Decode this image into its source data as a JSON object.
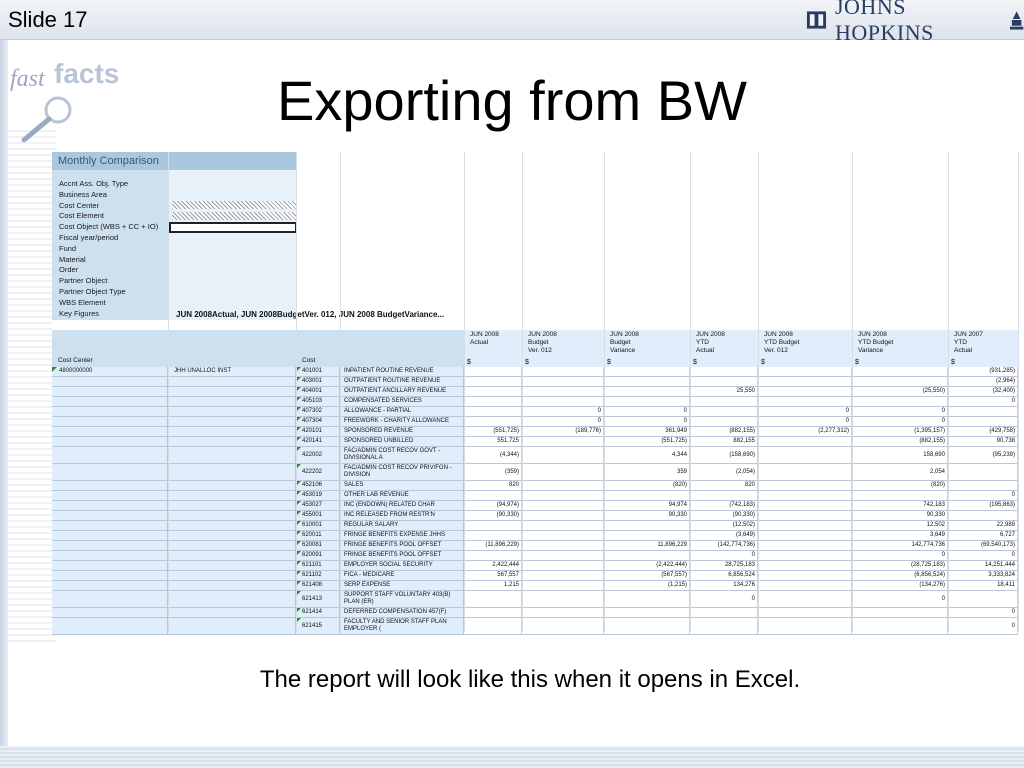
{
  "slide": {
    "label": "Slide 17",
    "brand": "JOHNS HOPKINS",
    "fastfacts_a": "fast",
    "fastfacts_b": "facts",
    "title": "Exporting from BW",
    "caption": "The report will look like this when it opens in Excel."
  },
  "sheet": {
    "header": "Monthly Comparison",
    "filters": [
      "Accnt Ass. Obj. Type",
      "Business Area",
      "Cost Center",
      "Cost Element",
      "Cost Object (WBS + CC + IO)",
      "Fiscal year/period",
      "Fund",
      "Material",
      "Order",
      "Partner Object",
      "Partner Object Type",
      "WBS Element",
      "Key Figures"
    ],
    "key_figures_value": "JUN 2008Actual, JUN 2008BudgetVer. 012, JUN 2008 BudgetVariance...",
    "cost_center_label": "Cost Center",
    "cost_label": "Cost",
    "currency": "$",
    "columns": [
      "JUN 2008\nActual",
      "JUN 2008\nBudget\nVer. 012",
      "JUN 2008\nBudget\nVariance",
      "JUN 2008\nYTD\nActual",
      "JUN 2008\nYTD Budget\nVer. 012",
      "JUN 2008\nYTD Budget\nVariance",
      "JUN 2007\nYTD\nActual"
    ],
    "cost_center": "4800000000",
    "cost_center_name": "JHH UNALLOC INST",
    "rows": [
      {
        "acct": "401001",
        "desc": "INPATIENT ROUTINE REVENUE",
        "v": [
          "",
          "",
          "",
          "",
          "",
          "",
          "(931,285)"
        ]
      },
      {
        "acct": "403001",
        "desc": "OUTPATIENT ROUTINE REVENUE",
        "v": [
          "",
          "",
          "",
          "",
          "",
          "",
          "(2,964)"
        ]
      },
      {
        "acct": "404001",
        "desc": "OUTPATIENT ANCILLARY REVENUE",
        "v": [
          "",
          "",
          "",
          "25,550",
          "",
          "(25,550)",
          "(32,400)"
        ]
      },
      {
        "acct": "405103",
        "desc": "COMPENSATED SERVICES",
        "v": [
          "",
          "",
          "",
          "",
          "",
          "",
          "0"
        ]
      },
      {
        "acct": "407302",
        "desc": "ALLOWANCE - PARTIAL",
        "v": [
          "",
          "0",
          "0",
          "",
          "0",
          "0",
          ""
        ]
      },
      {
        "acct": "407304",
        "desc": "FREEWORK - CHARITY ALLOWANCE",
        "v": [
          "",
          "0",
          "0",
          "",
          "0",
          "0",
          ""
        ]
      },
      {
        "acct": "420101",
        "desc": "SPONSORED REVENUE",
        "v": [
          "(551,725)",
          "(189,776)",
          "361,949",
          "(882,155)",
          "(2,277,312)",
          "(1,395,157)",
          "(429,758)"
        ]
      },
      {
        "acct": "420141",
        "desc": "SPONSORED UNBILLED",
        "v": [
          "551,725",
          "",
          "(551,725)",
          "882,155",
          "",
          "(882,155)",
          "90,738"
        ]
      },
      {
        "acct": "422002",
        "desc": "FAC/ADMIN COST RECOV GOVT - DIVISIONAL A",
        "v": [
          "(4,344)",
          "",
          "4,344",
          "(158,690)",
          "",
          "158,690",
          "(95,239)"
        ]
      },
      {
        "acct": "422202",
        "desc": "FAC/ADMIN COST RECOV PRIV/FGN - DIVISION",
        "v": [
          "(359)",
          "",
          "359",
          "(2,054)",
          "",
          "2,054",
          ""
        ]
      },
      {
        "acct": "452106",
        "desc": "SALES",
        "v": [
          "820",
          "",
          "(820)",
          "820",
          "",
          "(820)",
          ""
        ]
      },
      {
        "acct": "453019",
        "desc": "OTHER LAB REVENUE",
        "v": [
          "",
          "",
          "",
          "",
          "",
          "",
          "0"
        ]
      },
      {
        "acct": "453027",
        "desc": "INC (ENDOWN) RELATED CHAR",
        "v": [
          "(94,974)",
          "",
          "94,974",
          "(742,183)",
          "",
          "742,183",
          "(195,863)"
        ]
      },
      {
        "acct": "455001",
        "desc": "INC RELEASED FROM RESTR'N",
        "v": [
          "(90,330)",
          "",
          "90,330",
          "(90,330)",
          "",
          "90,330",
          ""
        ]
      },
      {
        "acct": "610001",
        "desc": "REGULAR SALARY",
        "v": [
          "",
          "",
          "",
          "(12,502)",
          "",
          "12,502",
          "22,989"
        ]
      },
      {
        "acct": "620011",
        "desc": "FRINGE BENEFITS EXPENSE JHHS",
        "v": [
          "",
          "",
          "",
          "(3,649)",
          "",
          "3,649",
          "6,727"
        ]
      },
      {
        "acct": "620081",
        "desc": "FRINGE BENEFITS POOL OFFSET",
        "v": [
          "(11,896,229)",
          "",
          "11,896,229",
          "(142,774,736)",
          "",
          "142,774,736",
          "(69,540,173)"
        ]
      },
      {
        "acct": "620091",
        "desc": "FRINGE BENEFITS POOL OFFSET",
        "v": [
          "",
          "",
          "",
          "0",
          "",
          "0",
          "0"
        ]
      },
      {
        "acct": "621101",
        "desc": "EMPLOYER SOCIAL SECURITY",
        "v": [
          "2,422,444",
          "",
          "(2,422,444)",
          "28,725,183",
          "",
          "(28,725,183)",
          "14,251,444"
        ]
      },
      {
        "acct": "621102",
        "desc": "FICA - MEDICARE",
        "v": [
          "567,557",
          "",
          "(567,557)",
          "6,856,524",
          "",
          "(6,856,524)",
          "3,333,824"
        ]
      },
      {
        "acct": "621408",
        "desc": "SERP EXPENSE",
        "v": [
          "1,215",
          "",
          "(1,215)",
          "134,276",
          "",
          "(134,276)",
          "18,411"
        ]
      },
      {
        "acct": "621413",
        "desc": "SUPPORT STAFF VOLUNTARY 403(B) PLAN (ER)",
        "v": [
          "",
          "",
          "",
          "0",
          "",
          "0",
          ""
        ]
      },
      {
        "acct": "621414",
        "desc": "DEFERRED COMPENSATION 457(F)",
        "v": [
          "",
          "",
          "",
          "",
          "",
          "",
          "0"
        ]
      },
      {
        "acct": "621415",
        "desc": "FACULTY AND SENIOR STAFF PLAN EMPLOYER (",
        "v": [
          "",
          "",
          "",
          "",
          "",
          "",
          "0"
        ]
      }
    ]
  },
  "icons": [
    "johns-hopkins-shield-icon",
    "lamp-icon",
    "magnifier-icon",
    "triangle-indicator-icon"
  ]
}
